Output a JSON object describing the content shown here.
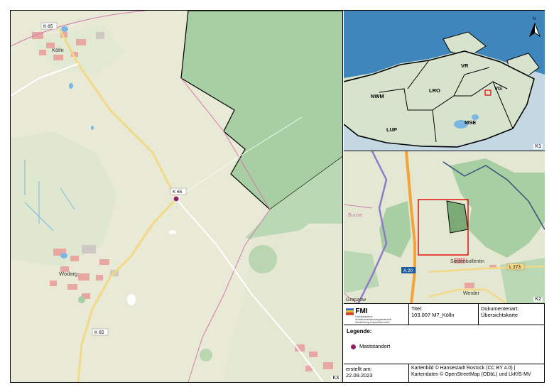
{
  "main_map": {
    "places": {
      "koelln": "Kölln",
      "wodarg": "Wodarg"
    },
    "roads": {
      "k65_north": "K 65",
      "k65_mid": "K 65",
      "k65_south": "K 65"
    },
    "frame_tag": "K3",
    "site_marker_color": "#8e2060",
    "colors": {
      "base": "#e8ead6",
      "forest": "#a7cfa3",
      "forest_outline": "#000000",
      "road": "#f3d986",
      "boundary": "#d47ab0",
      "settlement": "#e9a7a2",
      "water": "#7cb7e3"
    }
  },
  "overview_map": {
    "regions": {
      "vr": "VR",
      "lro": "LRO",
      "vg": "VG",
      "nwm": "NWM",
      "lup": "LUP",
      "mse": "MSE"
    },
    "north_arrow_label": "N",
    "frame_tag": "K1"
  },
  "detail_map": {
    "places": {
      "burow": "Burow",
      "siedenbollentin": "Siedenbollentin",
      "werder": "Werder",
      "grapzow": "Grapzow"
    },
    "roads": {
      "a20": "A 20",
      "l273": "L 273"
    },
    "frame_tag": "K2"
  },
  "info": {
    "logo_title": "FMI",
    "logo_line1": "Fachkompetenz Mobilfunkinfrastrukturgesellschaft",
    "logo_line2": "Mecklenburg-Vorpommern mbH",
    "title_label": "Titel:",
    "title_value": "103.007 M7_Kölln",
    "doctype_label": "Dokumentenart:",
    "doctype_value": "Übersichtskarte",
    "legend_heading": "Legende:",
    "legend_item": "Maststandort",
    "created_label": "erstellt am:",
    "created_value": "22.09.2023",
    "credits_line1": "Kartenbild © Hansestadt Rostock (CC BY 4.0) |",
    "credits_line2": "Kartendaten © OpenStreetMap (ODbL) und LkKfS-MV"
  }
}
